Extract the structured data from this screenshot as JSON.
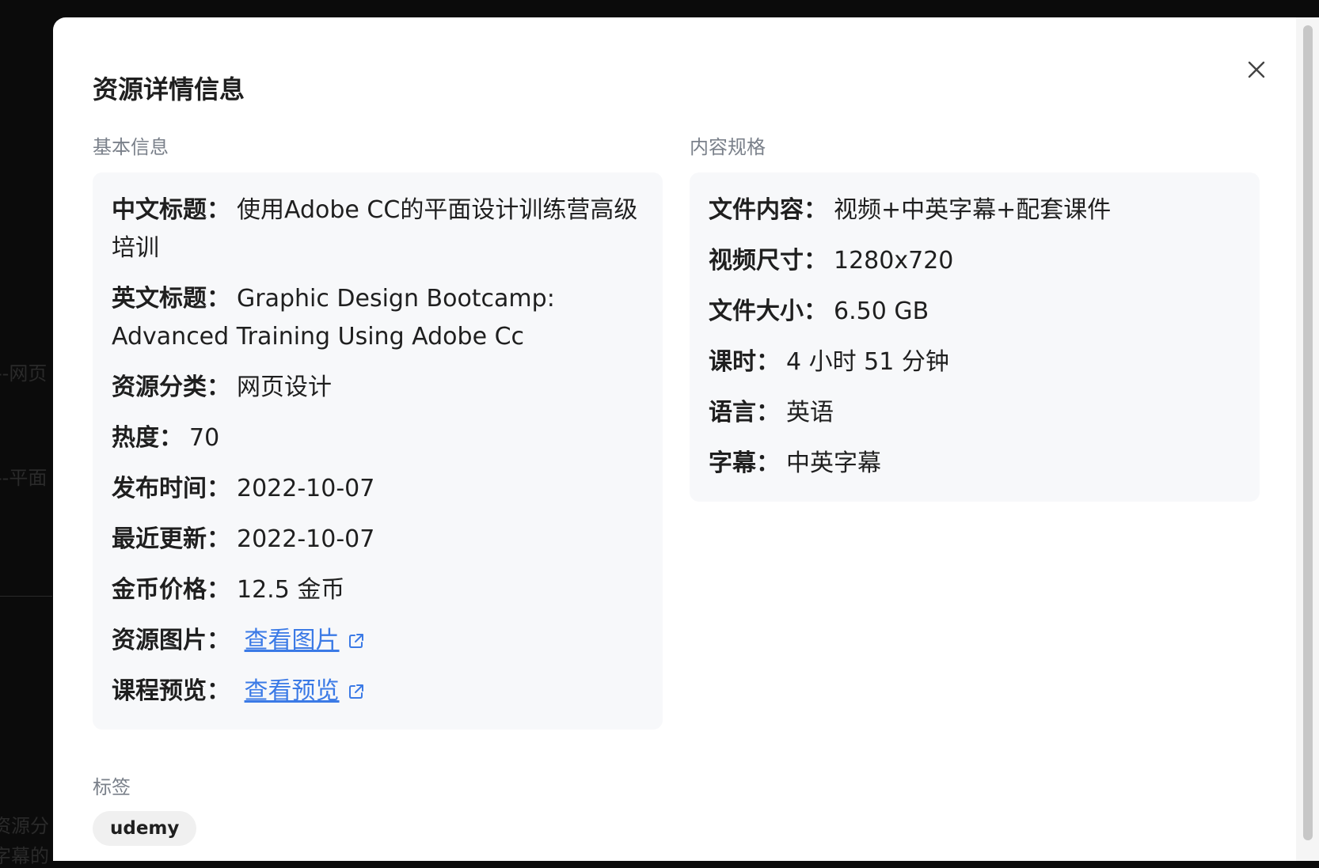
{
  "background": {
    "fragments": [
      "--网页",
      "--平面",
      "资源分",
      "字幕的"
    ]
  },
  "modal": {
    "title": "资源详情信息",
    "close_icon": "close-icon"
  },
  "basic_info": {
    "section_label": "基本信息",
    "chinese_title_key": "中文标题：",
    "chinese_title_value": "使用Adobe CC的平面设计训练营高级培训",
    "english_title_key": "英文标题：",
    "english_title_value": "Graphic Design Bootcamp: Advanced Training Using Adobe Cc",
    "category_key": "资源分类：",
    "category_value": "网页设计",
    "popularity_key": "热度：",
    "popularity_value": "70",
    "published_key": "发布时间：",
    "published_value": "2022-10-07",
    "updated_key": "最近更新：",
    "updated_value": "2022-10-07",
    "price_key": "金币价格：",
    "price_value": "12.5 金币",
    "image_key": "资源图片：",
    "image_link": "查看图片",
    "preview_key": "课程预览：",
    "preview_link": "查看预览"
  },
  "content_spec": {
    "section_label": "内容规格",
    "file_content_key": "文件内容：",
    "file_content_value": "视频+中英字幕+配套课件",
    "video_size_key": "视频尺寸：",
    "video_size_value": "1280x720",
    "file_size_key": "文件大小：",
    "file_size_value": "6.50 GB",
    "duration_key": "课时：",
    "duration_value": "4 小时 51 分钟",
    "language_key": "语言：",
    "language_value": "英语",
    "subtitle_key": "字幕：",
    "subtitle_value": "中英字幕"
  },
  "tags": {
    "section_label": "标签",
    "items": [
      "udemy"
    ]
  },
  "colors": {
    "link": "#3b7ae6",
    "card_bg": "#f7f8fa",
    "label_gray": "#7a808a"
  }
}
